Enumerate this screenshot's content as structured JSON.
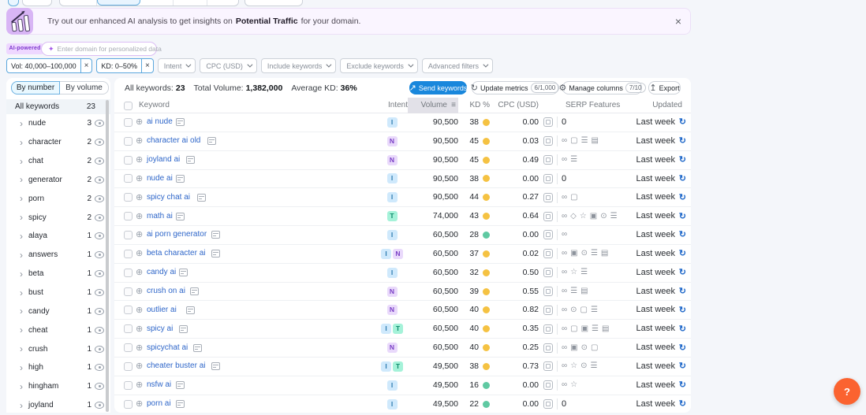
{
  "banner": {
    "text_prefix": "Try out our enhanced AI analysis to get insights on",
    "text_bold": "Potential Traffic",
    "text_suffix": "for your domain.",
    "close_label": "×"
  },
  "ai_bar": {
    "badge": "AI-powered",
    "sparkle": "✦",
    "placeholder": "Enter domain for personalized data"
  },
  "filters": {
    "active": [
      {
        "label": "Vol: 40,000–100,000",
        "remove": "×"
      },
      {
        "label": "KD: 0–50%",
        "remove": "×"
      }
    ],
    "dropdowns": [
      "Intent",
      "CPC (USD)",
      "Include keywords",
      "Exclude keywords",
      "Advanced filters"
    ]
  },
  "toolbar": {
    "view_tabs": [
      {
        "label": "By number",
        "selected": true
      },
      {
        "label": "By volume",
        "selected": false
      }
    ],
    "stats": [
      {
        "label": "All keywords:",
        "value": "23"
      },
      {
        "label": "Total Volume:",
        "value": "1,382,000"
      },
      {
        "label": "Average KD:",
        "value": "36%"
      }
    ],
    "send_button": "Send keywords",
    "update_button": "Update metrics",
    "update_badge": "6/1,000",
    "manage_button": "Manage columns",
    "manage_badge": "7/10",
    "export_button": "Export"
  },
  "sidebar": {
    "header": {
      "label": "All keywords",
      "count": "23"
    },
    "groups": [
      {
        "label": "nude",
        "count": "3"
      },
      {
        "label": "character",
        "count": "2"
      },
      {
        "label": "chat",
        "count": "2"
      },
      {
        "label": "generator",
        "count": "2"
      },
      {
        "label": "porn",
        "count": "2"
      },
      {
        "label": "spicy",
        "count": "2"
      },
      {
        "label": "alaya",
        "count": "1"
      },
      {
        "label": "answers",
        "count": "1"
      },
      {
        "label": "beta",
        "count": "1"
      },
      {
        "label": "bust",
        "count": "1"
      },
      {
        "label": "candy",
        "count": "1"
      },
      {
        "label": "cheat",
        "count": "1"
      },
      {
        "label": "crush",
        "count": "1"
      },
      {
        "label": "high",
        "count": "1"
      },
      {
        "label": "hingham",
        "count": "1"
      },
      {
        "label": "joyland",
        "count": "1"
      }
    ]
  },
  "table": {
    "columns": {
      "keyword": "Keyword",
      "intent": "Intent",
      "volume": "Volume",
      "kd": "KD %",
      "cpc": "CPC (USD)",
      "serp": "SERP Features",
      "updated": "Updated"
    },
    "intent_styles": {
      "I": {
        "bg": "#cfe9fc",
        "fg": "#2f7db0"
      },
      "N": {
        "bg": "#e9d9fb",
        "fg": "#7a3fc5"
      },
      "T": {
        "bg": "#a5f2d9",
        "fg": "#0d8a6b"
      }
    },
    "kd_colors": {
      "medium": "#f5c242",
      "easy": "#5fc9a2"
    },
    "serp_glyphs": {
      "sitelinks": "∞",
      "reviews": "☆",
      "featured-snippet": "◇",
      "image-pack": "▣",
      "knowledge-panel": "▤",
      "people-also-ask": "▢",
      "instant-answer": "⊙",
      "top-stories": "☰"
    },
    "rows": [
      {
        "keyword": "ai nude",
        "intents": [
          "I"
        ],
        "volume": "90,500",
        "kd": "38",
        "kd_level": "medium",
        "cpc": "0.00",
        "serp_count": "0",
        "serp": [],
        "updated": "Last week"
      },
      {
        "keyword": "character ai old",
        "intents": [
          "N"
        ],
        "volume": "90,500",
        "kd": "45",
        "kd_level": "medium",
        "cpc": "0.03",
        "serp": [
          "sitelinks",
          "people-also-ask",
          "top-stories",
          "knowledge-panel"
        ],
        "updated": "Last week"
      },
      {
        "keyword": "joyland ai",
        "intents": [
          "N"
        ],
        "volume": "90,500",
        "kd": "45",
        "kd_level": "medium",
        "cpc": "0.49",
        "serp": [
          "sitelinks",
          "top-stories"
        ],
        "updated": "Last week"
      },
      {
        "keyword": "nude ai",
        "intents": [
          "I"
        ],
        "volume": "90,500",
        "kd": "38",
        "kd_level": "medium",
        "cpc": "0.00",
        "serp_count": "0",
        "serp": [],
        "updated": "Last week"
      },
      {
        "keyword": "spicy chat ai",
        "intents": [
          "I"
        ],
        "volume": "90,500",
        "kd": "44",
        "kd_level": "medium",
        "cpc": "0.27",
        "serp": [
          "sitelinks",
          "people-also-ask"
        ],
        "updated": "Last week"
      },
      {
        "keyword": "math ai",
        "intents": [
          "T"
        ],
        "volume": "74,000",
        "kd": "43",
        "kd_level": "medium",
        "cpc": "0.64",
        "serp": [
          "sitelinks",
          "featured-snippet",
          "reviews",
          "image-pack",
          "instant-answer",
          "top-stories"
        ],
        "updated": "Last week"
      },
      {
        "keyword": "ai porn generator",
        "intents": [
          "I"
        ],
        "volume": "60,500",
        "kd": "28",
        "kd_level": "easy",
        "cpc": "0.00",
        "serp": [
          "sitelinks"
        ],
        "updated": "Last week"
      },
      {
        "keyword": "beta character ai",
        "intents": [
          "I",
          "N"
        ],
        "volume": "60,500",
        "kd": "37",
        "kd_level": "medium",
        "cpc": "0.02",
        "serp": [
          "sitelinks",
          "image-pack",
          "instant-answer",
          "top-stories",
          "knowledge-panel"
        ],
        "updated": "Last week"
      },
      {
        "keyword": "candy ai",
        "intents": [
          "I"
        ],
        "volume": "60,500",
        "kd": "32",
        "kd_level": "medium",
        "cpc": "0.50",
        "serp": [
          "sitelinks",
          "reviews",
          "top-stories"
        ],
        "updated": "Last week"
      },
      {
        "keyword": "crush on ai",
        "intents": [
          "N"
        ],
        "volume": "60,500",
        "kd": "39",
        "kd_level": "medium",
        "cpc": "0.55",
        "serp": [
          "sitelinks",
          "top-stories",
          "knowledge-panel"
        ],
        "updated": "Last week"
      },
      {
        "keyword": "outlier ai",
        "intents": [
          "N"
        ],
        "volume": "60,500",
        "kd": "40",
        "kd_level": "medium",
        "cpc": "0.82",
        "serp": [
          "sitelinks",
          "instant-answer",
          "people-also-ask",
          "top-stories"
        ],
        "updated": "Last week"
      },
      {
        "keyword": "spicy ai",
        "intents": [
          "I",
          "T"
        ],
        "volume": "60,500",
        "kd": "40",
        "kd_level": "medium",
        "cpc": "0.35",
        "serp": [
          "sitelinks",
          "people-also-ask",
          "image-pack",
          "top-stories",
          "knowledge-panel"
        ],
        "updated": "Last week"
      },
      {
        "keyword": "spicychat ai",
        "intents": [
          "N"
        ],
        "volume": "60,500",
        "kd": "40",
        "kd_level": "medium",
        "cpc": "0.25",
        "serp": [
          "sitelinks",
          "image-pack",
          "instant-answer",
          "people-also-ask"
        ],
        "updated": "Last week"
      },
      {
        "keyword": "cheater buster ai",
        "intents": [
          "I",
          "T"
        ],
        "volume": "49,500",
        "kd": "38",
        "kd_level": "medium",
        "cpc": "0.73",
        "serp": [
          "sitelinks",
          "reviews",
          "instant-answer",
          "top-stories"
        ],
        "updated": "Last week"
      },
      {
        "keyword": "nsfw ai",
        "intents": [
          "I"
        ],
        "volume": "49,500",
        "kd": "16",
        "kd_level": "easy",
        "cpc": "0.00",
        "serp": [
          "sitelinks",
          "reviews"
        ],
        "updated": "Last week"
      },
      {
        "keyword": "porn ai",
        "intents": [
          "I"
        ],
        "volume": "49,500",
        "kd": "22",
        "kd_level": "easy",
        "cpc": "0.00",
        "serp_count": "0",
        "serp": [],
        "updated": "Last week"
      }
    ]
  },
  "help": {
    "label": "?"
  }
}
